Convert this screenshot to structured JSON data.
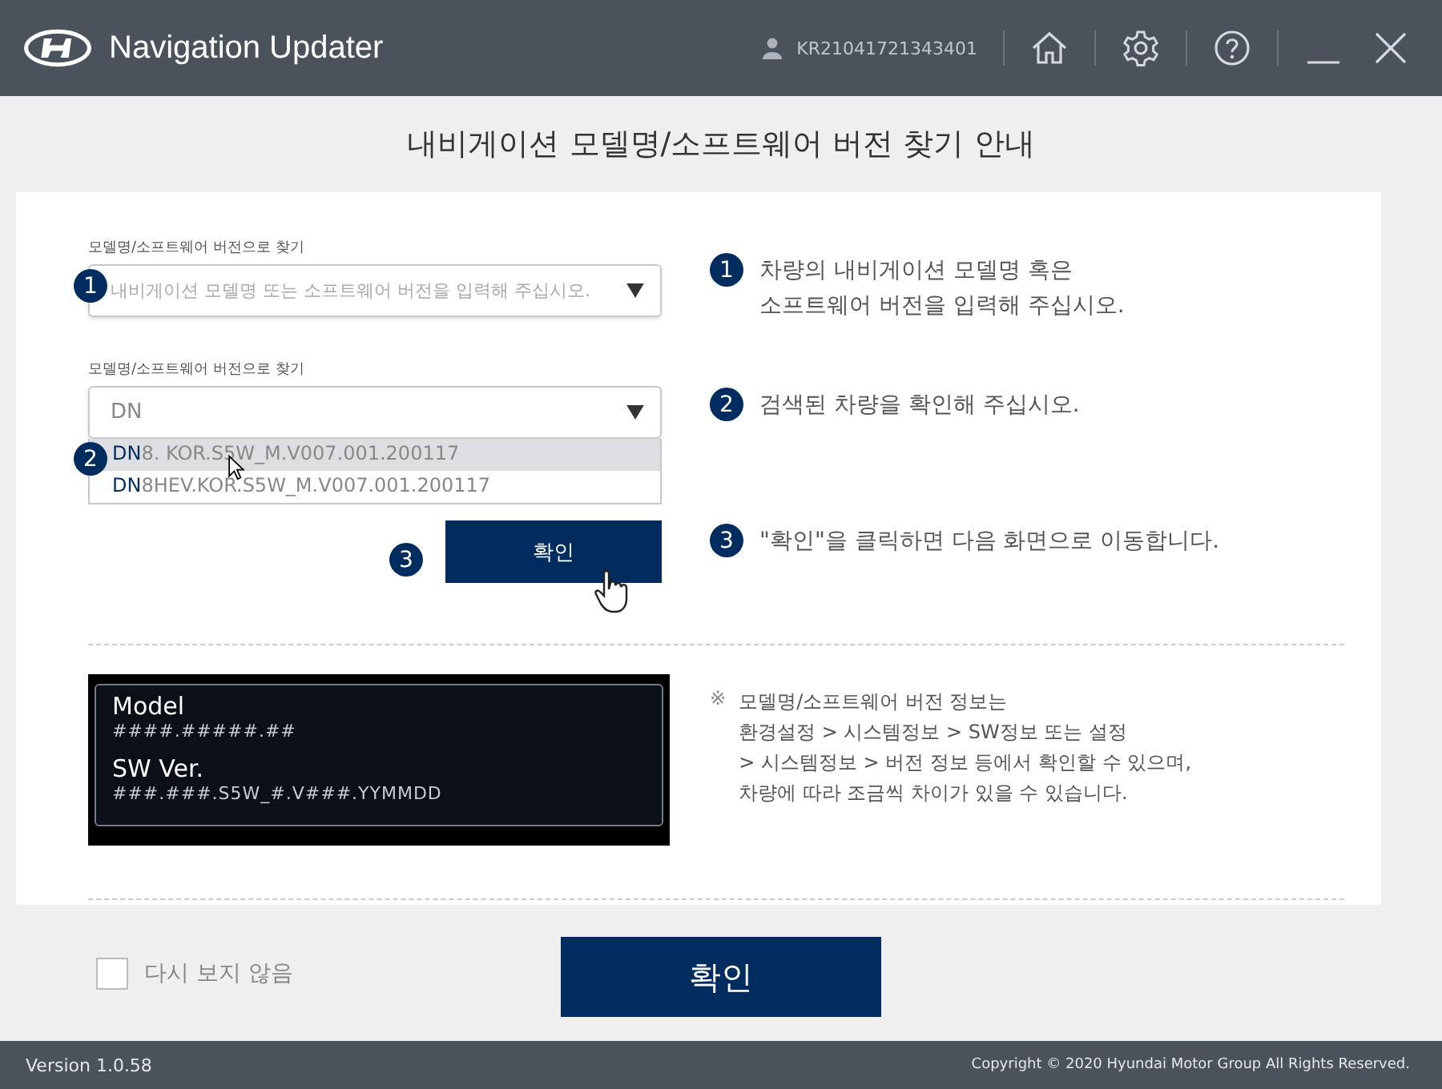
{
  "header": {
    "app_title": "Navigation Updater",
    "user_id": "KR21041721343401"
  },
  "page_title": "내비게이션 모델명/소프트웨어 버전 찾기 안내",
  "search_fields": [
    {
      "badge": "1",
      "label": "모델명/소프트웨어 버전으로 찾기",
      "placeholder": "내비게이션 모델명 또는 소프트웨어 버전을 입력해 주십시오."
    },
    {
      "badge": "2",
      "label": "모델명/소프트웨어 버전으로 찾기",
      "value": "DN"
    }
  ],
  "dropdown_items": [
    {
      "match": "DN",
      "rest": "8. KOR.S5W_M.V007.001.200117",
      "selected": true
    },
    {
      "match": "DN",
      "rest": "8HEV.KOR.S5W_M.V007.001.200117",
      "selected": false
    }
  ],
  "confirm_step": {
    "badge": "3",
    "label": "확인"
  },
  "steps": [
    {
      "number": "1",
      "lines": [
        "차량의 내비게이션 모델명 혹은",
        "소프트웨어 버전을 입력해 주십시오."
      ]
    },
    {
      "number": "2",
      "lines": [
        "검색된 차량을 확인해 주십시오."
      ]
    },
    {
      "number": "3",
      "lines": [
        "\"확인\"을 클릭하면 다음 화면으로 이동합니다."
      ]
    }
  ],
  "display_sample": {
    "model_label": "Model",
    "model_format": "####.#####.##",
    "version_label": "SW Ver.",
    "version_format": "###.###.S5W_#.V###.YYMMDD"
  },
  "note": {
    "mark": "※",
    "lines": [
      "모델명/소프트웨어 버전 정보는",
      "환경설정 > 시스템정보 > SW정보 또는 설정",
      "> 시스템정보 > 버전 정보 등에서 확인할 수 있으며,",
      "차량에 따라 조금씩 차이가 있을 수 있습니다."
    ]
  },
  "bottom_bar": {
    "dont_show_again": {
      "label": "다시 보지 않음",
      "checked": false
    },
    "confirm_button": "확인"
  },
  "status_bar": {
    "version": "Version 1.0.58",
    "copyright": "Copyright © 2020 Hyundai Motor Group All Rights Reserved."
  }
}
